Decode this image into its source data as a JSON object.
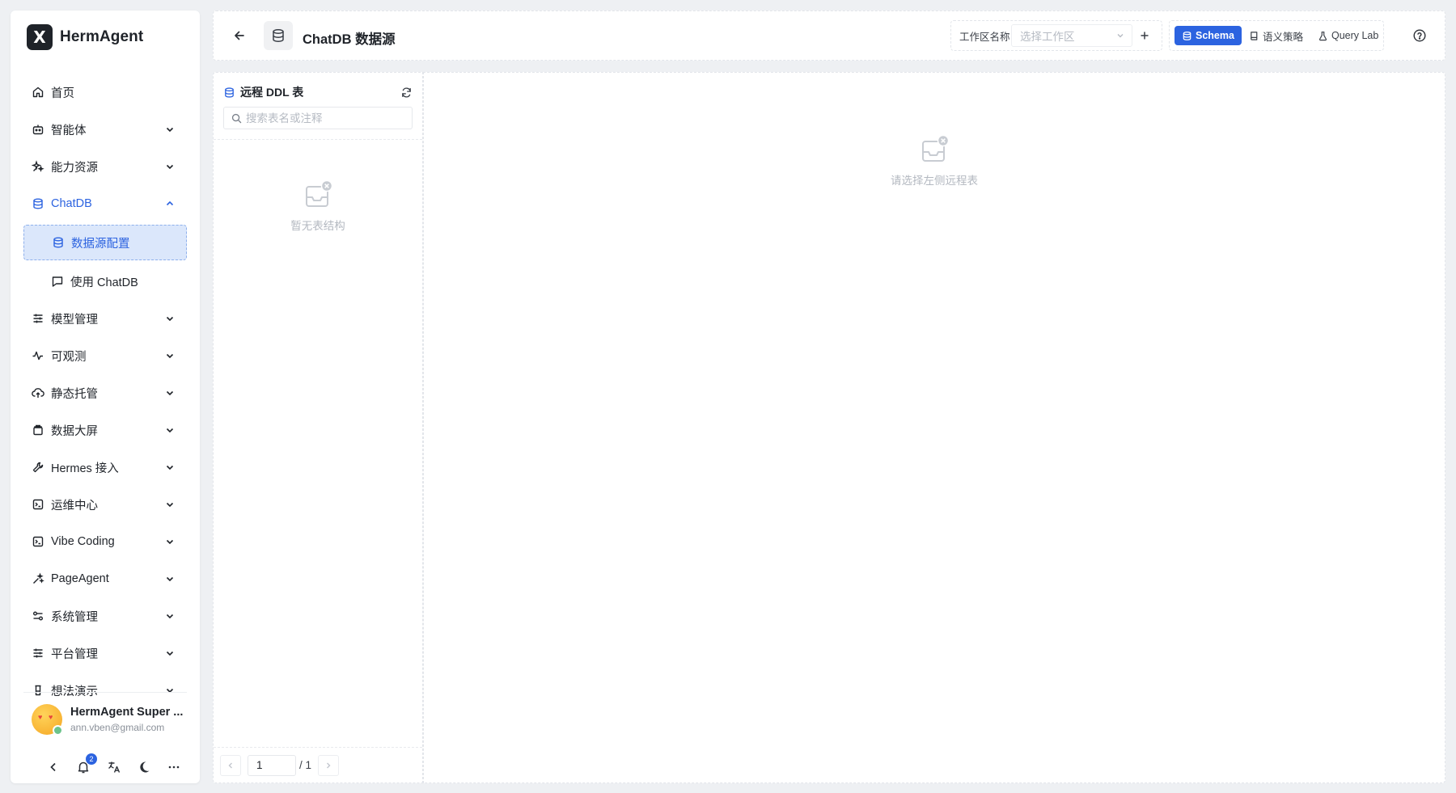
{
  "app": {
    "brand_mark": "X",
    "brand_name": "HermAgent"
  },
  "sidebar": {
    "items": [
      {
        "label": "首页",
        "icon": "home-icon",
        "expandable": false
      },
      {
        "label": "智能体",
        "icon": "robot-icon",
        "expandable": true
      },
      {
        "label": "能力资源",
        "icon": "sparkles-icon",
        "expandable": true
      },
      {
        "label": "ChatDB",
        "icon": "database-icon",
        "expandable": true,
        "open": true
      },
      {
        "label": "模型管理",
        "icon": "sliders-icon",
        "expandable": true
      },
      {
        "label": "可观测",
        "icon": "activity-icon",
        "expandable": true
      },
      {
        "label": "静态托管",
        "icon": "cloud-upload-icon",
        "expandable": true
      },
      {
        "label": "数据大屏",
        "icon": "screen-icon",
        "expandable": true
      },
      {
        "label": "Hermes 接入",
        "icon": "wrench-icon",
        "expandable": true
      },
      {
        "label": "运维中心",
        "icon": "terminal-icon",
        "expandable": true
      },
      {
        "label": "Vibe Coding",
        "icon": "terminal-icon",
        "expandable": true
      },
      {
        "label": "PageAgent",
        "icon": "magic-wand-icon",
        "expandable": true
      },
      {
        "label": "系统管理",
        "icon": "settings-toggle-icon",
        "expandable": true
      },
      {
        "label": "平台管理",
        "icon": "sliders-icon",
        "expandable": true
      },
      {
        "label": "想法演示",
        "icon": "flask-icon",
        "expandable": true
      }
    ],
    "chatdb_children": [
      {
        "label": "数据源配置",
        "icon": "database-icon",
        "active": true
      },
      {
        "label": "使用 ChatDB",
        "icon": "chat-icon",
        "active": false
      }
    ],
    "user": {
      "name": "HermAgent Super ...",
      "email": "ann.vben@gmail.com"
    },
    "notification_count": "2"
  },
  "header": {
    "title": "ChatDB 数据源",
    "workspace_label": "工作区名称",
    "workspace_placeholder": "选择工作区",
    "modes": [
      {
        "label": "Schema",
        "active": true,
        "icon": "database-icon"
      },
      {
        "label": "语义策略",
        "active": false,
        "icon": "book-icon"
      },
      {
        "label": "Query Lab",
        "active": false,
        "icon": "flask-icon"
      }
    ]
  },
  "left_panel": {
    "title": "远程 DDL 表",
    "search_placeholder": "搜索表名或注释",
    "empty_text": "暂无表结构",
    "pagination": {
      "current": "1",
      "total": "/ 1"
    }
  },
  "right_panel": {
    "empty_text": "请选择左侧远程表"
  },
  "colors": {
    "accent": "#2c63e0",
    "active_bg": "#dbe7fb",
    "page_bg": "#eef0f3"
  }
}
